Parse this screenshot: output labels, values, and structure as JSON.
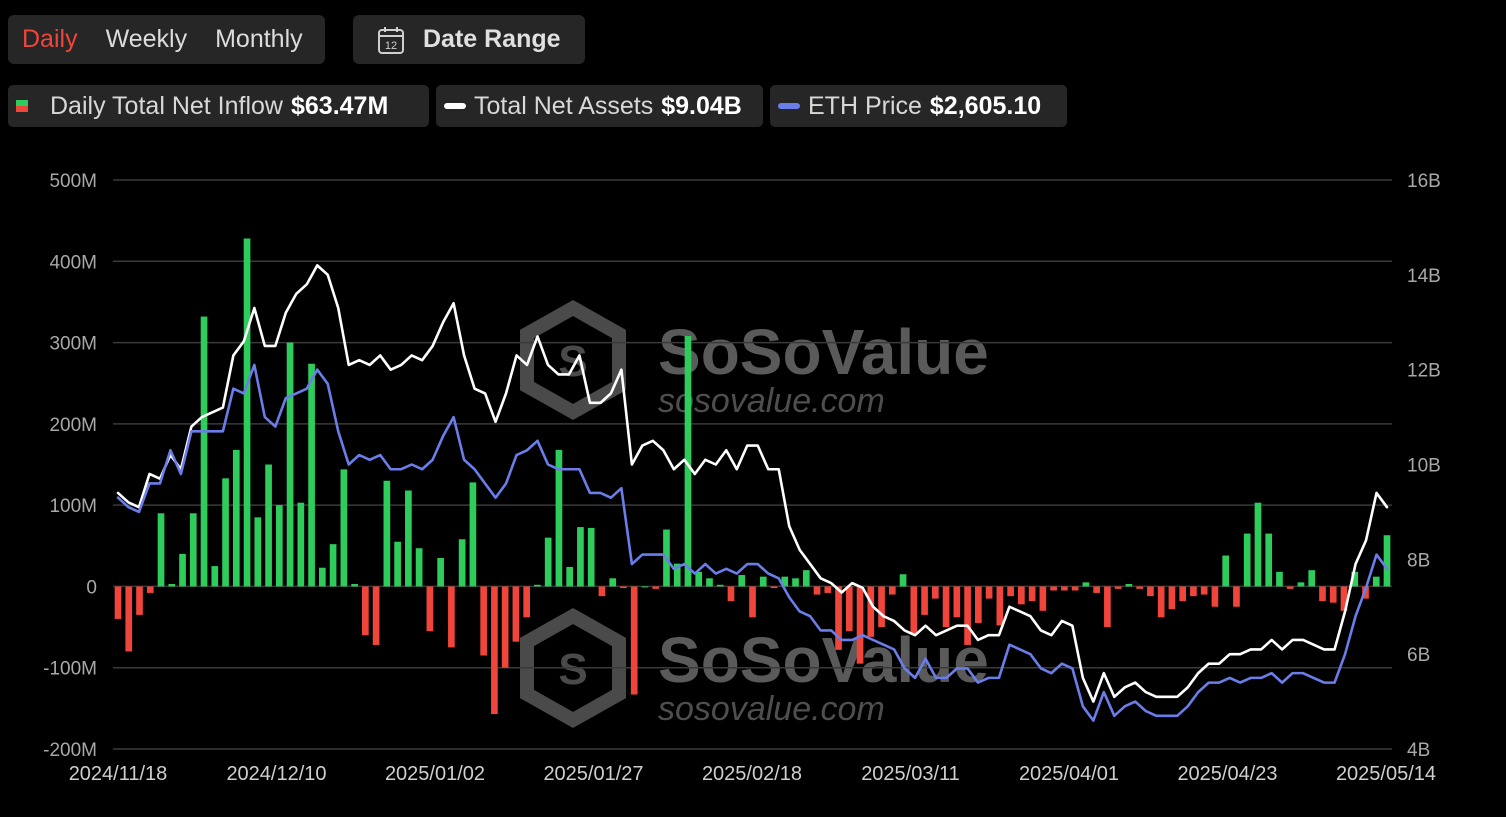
{
  "tabs": [
    {
      "label": "Daily",
      "active": true
    },
    {
      "label": "Weekly",
      "active": false
    },
    {
      "label": "Monthly",
      "active": false
    }
  ],
  "date_range_label": "Date Range",
  "calendar_day": "12",
  "legend": {
    "inflow": {
      "label": "Daily Total Net Inflow",
      "value": "$63.47M"
    },
    "assets": {
      "label": "Total Net Assets",
      "value": "$9.04B"
    },
    "eth": {
      "label": "ETH Price",
      "value": "$2,605.10"
    }
  },
  "watermark": {
    "brand": "SoSoValue",
    "url": "sosovalue.com"
  },
  "colors": {
    "positive": "#2ecc5a",
    "negative": "#f0453a",
    "assets_line": "#ffffff",
    "eth_line": "#6b7de8",
    "active_tab": "#f0453a"
  },
  "chart_data": {
    "type": "bar+line",
    "x_ticks": [
      "2024/11/18",
      "2024/12/10",
      "2025/01/02",
      "2025/01/27",
      "2025/02/18",
      "2025/03/11",
      "2025/04/01",
      "2025/04/23",
      "2025/05/14"
    ],
    "left_axis": {
      "ticks": [
        "500M",
        "400M",
        "300M",
        "200M",
        "100M",
        "0",
        "-100M",
        "-200M"
      ],
      "ylim": [
        -200,
        500
      ],
      "unit": "M"
    },
    "right_axis": {
      "ticks": [
        "16B",
        "14B",
        "12B",
        "10B",
        "8B",
        "6B",
        "4B"
      ],
      "ylim": [
        4,
        16
      ],
      "unit": "B"
    },
    "grid": true,
    "series": [
      {
        "key": "inflow",
        "kind": "bar",
        "values": [
          -40,
          -80,
          -35,
          -8,
          90,
          3,
          40,
          90,
          332,
          25,
          133,
          168,
          428,
          85,
          150,
          100,
          300,
          103,
          274,
          23,
          52,
          144,
          3,
          -60,
          -72,
          130,
          55,
          118,
          47,
          -55,
          35,
          -75,
          58,
          128,
          -85,
          -157,
          -100,
          -68,
          -38,
          2,
          60,
          168,
          24,
          73,
          72,
          -12,
          10,
          -2,
          -133,
          0,
          -3,
          70,
          28,
          308,
          18,
          10,
          2,
          -18,
          14,
          -38,
          12,
          -2,
          12,
          10,
          20,
          -10,
          -8,
          -78,
          -55,
          -95,
          -62,
          -50,
          -10,
          15,
          -58,
          -35,
          -15,
          -50,
          -38,
          -72,
          -45,
          -15,
          -48,
          -12,
          -22,
          -18,
          -30,
          -5,
          -5,
          -5,
          5,
          -8,
          -50,
          -3,
          3,
          -3,
          -12,
          -38,
          -28,
          -18,
          -12,
          -10,
          -25,
          38,
          -25,
          65,
          103,
          65,
          18,
          -3,
          5,
          20,
          -18,
          -20,
          -30,
          18,
          -15,
          12,
          63
        ]
      },
      {
        "key": "assets",
        "kind": "line",
        "values": [
          9.4,
          9.2,
          9.1,
          9.8,
          9.7,
          10.2,
          9.9,
          10.8,
          11.0,
          11.1,
          11.2,
          12.3,
          12.6,
          13.3,
          12.5,
          12.5,
          13.2,
          13.6,
          13.8,
          14.2,
          14.0,
          13.3,
          12.1,
          12.2,
          12.1,
          12.3,
          12.0,
          12.1,
          12.3,
          12.2,
          12.5,
          13.0,
          13.4,
          12.3,
          11.6,
          11.5,
          10.9,
          11.5,
          12.3,
          12.1,
          12.7,
          12.1,
          11.9,
          11.9,
          12.3,
          11.3,
          11.3,
          11.5,
          12.0,
          10.0,
          10.4,
          10.5,
          10.3,
          9.9,
          10.1,
          9.8,
          10.1,
          10.0,
          10.3,
          9.9,
          10.4,
          10.4,
          9.9,
          9.9,
          8.7,
          8.2,
          7.9,
          7.6,
          7.5,
          7.3,
          7.5,
          7.4,
          7.0,
          6.8,
          6.7,
          6.5,
          6.4,
          6.6,
          6.4,
          6.5,
          6.6,
          6.6,
          6.3,
          6.4,
          6.4,
          7.0,
          6.9,
          6.8,
          6.5,
          6.4,
          6.7,
          6.6,
          5.5,
          5.0,
          5.6,
          5.1,
          5.3,
          5.4,
          5.2,
          5.1,
          5.1,
          5.1,
          5.3,
          5.6,
          5.8,
          5.8,
          6.0,
          6.0,
          6.1,
          6.1,
          6.3,
          6.1,
          6.3,
          6.3,
          6.2,
          6.1,
          6.1,
          6.9,
          7.9,
          8.4,
          9.4,
          9.1
        ]
      },
      {
        "key": "eth",
        "kind": "line",
        "values": [
          9.3,
          9.1,
          9.0,
          9.6,
          9.6,
          10.3,
          9.8,
          10.7,
          10.7,
          10.7,
          10.7,
          11.6,
          11.5,
          12.1,
          11.0,
          10.8,
          11.4,
          11.5,
          11.6,
          12.0,
          11.7,
          10.7,
          10.0,
          10.2,
          10.1,
          10.2,
          9.9,
          9.9,
          10.0,
          9.9,
          10.1,
          10.6,
          11.0,
          10.1,
          9.9,
          9.6,
          9.3,
          9.6,
          10.2,
          10.3,
          10.5,
          10.0,
          9.9,
          9.9,
          9.9,
          9.4,
          9.4,
          9.3,
          9.5,
          7.9,
          8.1,
          8.1,
          8.1,
          7.8,
          7.9,
          7.7,
          7.9,
          7.7,
          7.8,
          7.7,
          7.9,
          7.9,
          7.7,
          7.6,
          7.2,
          6.9,
          6.8,
          6.5,
          6.5,
          6.3,
          6.3,
          6.4,
          6.3,
          6.2,
          6.1,
          5.7,
          5.5,
          5.9,
          5.5,
          5.5,
          5.7,
          5.7,
          5.4,
          5.5,
          5.5,
          6.2,
          6.1,
          6.0,
          5.7,
          5.6,
          5.8,
          5.7,
          4.9,
          4.6,
          5.2,
          4.7,
          4.9,
          5.0,
          4.8,
          4.7,
          4.7,
          4.7,
          4.9,
          5.2,
          5.4,
          5.4,
          5.5,
          5.4,
          5.5,
          5.5,
          5.6,
          5.4,
          5.6,
          5.6,
          5.5,
          5.4,
          5.4,
          6.0,
          6.8,
          7.4,
          8.1,
          7.8
        ]
      }
    ]
  }
}
